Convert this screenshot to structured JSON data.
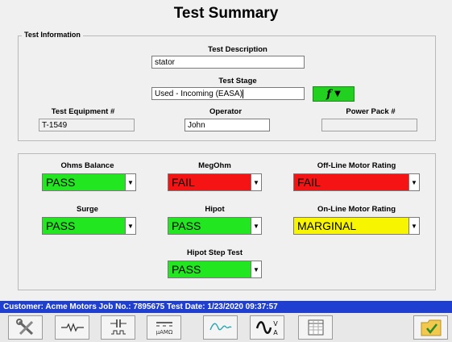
{
  "page_title": "Test Summary",
  "info_group": {
    "legend": "Test Information",
    "test_description_label": "Test Description",
    "test_description_value": "stator",
    "test_stage_label": "Test Stage",
    "test_stage_value": "Used - Incoming (EASA)",
    "test_equipment_label": "Test Equipment #",
    "test_equipment_value": "T-1549",
    "operator_label": "Operator",
    "operator_value": "John",
    "power_pack_label": "Power Pack #",
    "power_pack_value": ""
  },
  "results": {
    "ohms_balance": {
      "label": "Ohms Balance",
      "value": "PASS"
    },
    "megohm": {
      "label": "MegOhm",
      "value": "FAIL"
    },
    "offline_rating": {
      "label": "Off-Line Motor Rating",
      "value": "FAIL"
    },
    "surge": {
      "label": "Surge",
      "value": "PASS"
    },
    "hipot": {
      "label": "Hipot",
      "value": "PASS"
    },
    "online_rating": {
      "label": "On-Line Motor Rating",
      "value": "MARGINAL"
    },
    "hipot_step": {
      "label": "Hipot Step Test",
      "value": "PASS"
    }
  },
  "status_bar": "Customer: Acme Motors   Job No.: 7895675   Test Date: 1/23/2020 09:37:57",
  "colors": {
    "pass": "#22e61f",
    "fail": "#f51313",
    "marginal": "#f7f500",
    "status_bar": "#1f3fd1"
  },
  "toolbar_icons": [
    "tools-icon",
    "resistor-icon",
    "capacitor-icon",
    "dc-meter-icon",
    "waveform-icon",
    "ac-voltage-icon",
    "table-icon",
    "checkmark-folder-icon"
  ]
}
